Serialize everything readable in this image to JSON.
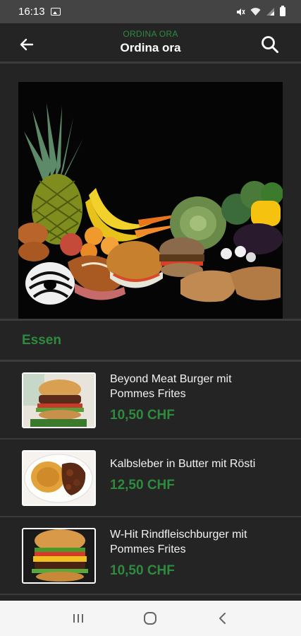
{
  "status_bar": {
    "time": "16:13",
    "icons": [
      "gallery-icon",
      "mute-icon",
      "wifi-icon",
      "signal-icon",
      "battery-icon"
    ]
  },
  "app_bar": {
    "subtitle": "ORDINA ORA",
    "title": "Ordina ora",
    "back_icon": "back-arrow-icon",
    "search_icon": "search-icon"
  },
  "hero": {
    "image": "food-assortment-photo"
  },
  "section": {
    "title": "Essen"
  },
  "menu_items": [
    {
      "name": "Beyond Meat Burger mit Pommes Frites",
      "price": "10,50 CHF",
      "thumb": "burger-photo"
    },
    {
      "name": "Kalbsleber in Butter mit Rösti",
      "price": "12,50 CHF",
      "thumb": "liver-rosti-photo"
    },
    {
      "name": "W-Hit Rindfleischburger mit Pommes Frites",
      "price": "10,50 CHF",
      "thumb": "beef-burger-photo"
    }
  ],
  "nav_bar": {
    "icons": [
      "recent-apps-icon",
      "home-icon",
      "back-icon"
    ]
  },
  "colors": {
    "background": "#242424",
    "accent_green": "#2e8b3e",
    "status_bar": "#444444",
    "nav_bar": "#f5f5f5"
  }
}
